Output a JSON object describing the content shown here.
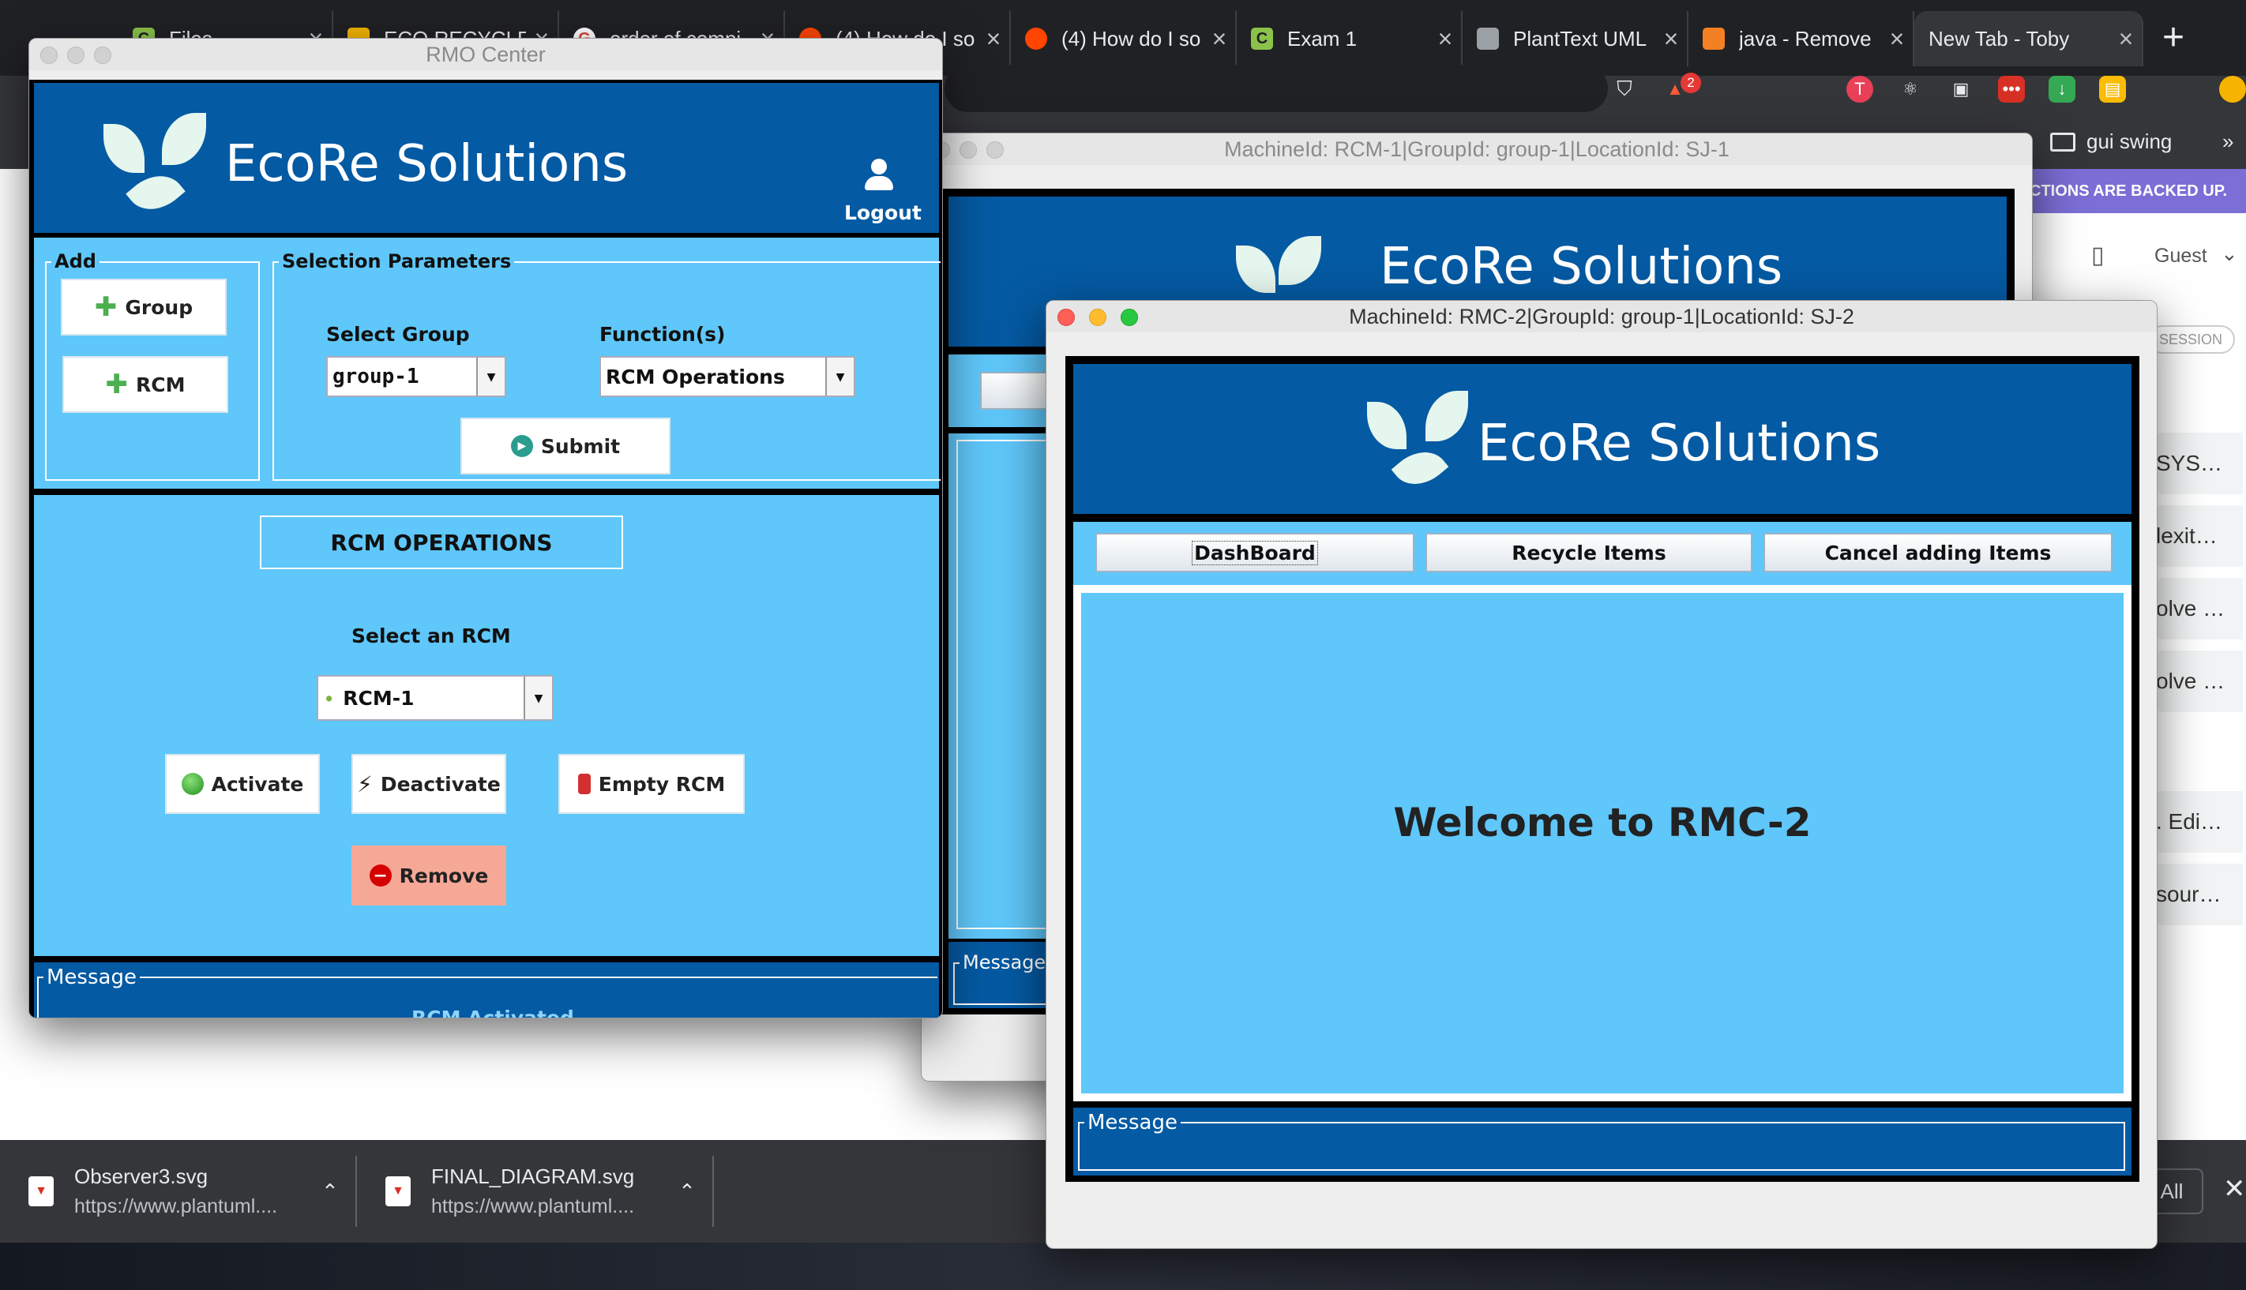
{
  "browser": {
    "tabs": [
      {
        "label": "Files",
        "icon": "c-icon"
      },
      {
        "label": "ECO RECYCLE",
        "icon": "slides-icon"
      },
      {
        "label": "order of compi",
        "icon": "google-icon"
      },
      {
        "label": "(4) How do I so",
        "icon": "reddit-icon"
      },
      {
        "label": "(4) How do I so",
        "icon": "reddit-icon"
      },
      {
        "label": "Exam 1",
        "icon": "c-icon"
      },
      {
        "label": "PlantText UML",
        "icon": "planttext-icon"
      },
      {
        "label": "java - Remove",
        "icon": "stackoverflow-icon"
      },
      {
        "label": "New Tab - Toby",
        "icon": ""
      }
    ],
    "new_tab": "+",
    "brave_badge": "2",
    "bookmark_folder": "gui swing",
    "bookmark_more": "»",
    "guest_label": "Guest"
  },
  "page": {
    "banner": "CTIONS ARE BACKED UP.",
    "session_badge": "SESSION",
    "right_items": [
      "SYS…",
      "lexit…",
      "olve …",
      "olve …",
      ". Edi…",
      "sour…"
    ]
  },
  "downloads": {
    "items": [
      {
        "name": "Observer3.svg",
        "url": "https://www.plantuml...."
      },
      {
        "name": "FINAL_DIAGRAM.svg",
        "url": "https://www.plantuml...."
      }
    ],
    "show_all": "All",
    "close": "✕"
  },
  "rmo": {
    "title": "RMO Center",
    "brand": "EcoRe Solutions",
    "logout": "Logout",
    "add_group_title": "Add",
    "add_group_button": "Group",
    "add_rcm_button": "RCM",
    "selection_title": "Selection Parameters",
    "select_group_label": "Select Group",
    "group_value": "group-1",
    "functions_label": "Function(s)",
    "function_value": "RCM Operations",
    "submit": "Submit",
    "section_title": "RCM OPERATIONS",
    "select_rcm_label": "Select an RCM",
    "rcm_value": "RCM-1",
    "activate": "Activate",
    "deactivate": "Deactivate",
    "empty_rcm": "Empty RCM",
    "remove": "Remove",
    "message_title": "Message",
    "message_text": "RCM Activated"
  },
  "rcm1": {
    "title": "MachineId: RCM-1|GroupId: group-1|LocationId: SJ-1",
    "brand": "EcoRe Solutions",
    "message_title": "Message"
  },
  "rmc2": {
    "title": "MachineId: RMC-2|GroupId: group-1|LocationId: SJ-2",
    "brand": "EcoRe Solutions",
    "tabs": [
      "DashBoard",
      "Recycle Items",
      "Cancel adding Items"
    ],
    "welcome": "Welcome to RMC-2",
    "message_title": "Message"
  },
  "colors": {
    "dark_blue": "#045aa3",
    "light_blue": "#5fc7fa",
    "remove_button": "#f6a896",
    "mac_close": "#fe5f57",
    "mac_min": "#febc2e",
    "mac_max": "#28c840"
  }
}
